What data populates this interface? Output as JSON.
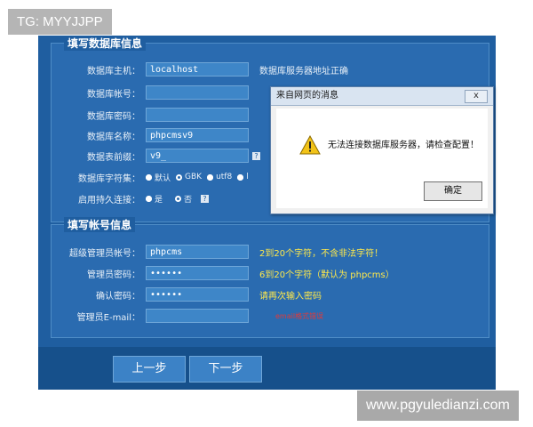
{
  "watermarks": {
    "top": "TG: MYYJJPP",
    "bottom": "www.pgyuledianzi.com"
  },
  "db_section": {
    "legend": "填写数据库信息",
    "host": {
      "label": "数据库主机：",
      "value": "localhost",
      "hint": "数据库服务器地址正确"
    },
    "user": {
      "label": "数据库帐号：",
      "value": ""
    },
    "password": {
      "label": "数据库密码：",
      "value": ""
    },
    "name": {
      "label": "数据库名称：",
      "value": "phpcmsv9"
    },
    "prefix": {
      "label": "数据表前缀：",
      "value": "v9_"
    },
    "charset": {
      "label": "数据库字符集：",
      "options": [
        "默认",
        "GBK",
        "utf8",
        "l"
      ]
    },
    "persistent": {
      "label": "启用持久连接：",
      "options": [
        "是",
        "否"
      ]
    }
  },
  "account_section": {
    "legend": "填写帐号信息",
    "admin_user": {
      "label": "超级管理员帐号：",
      "value": "phpcms",
      "hint": "2到20个字符，不含非法字符！"
    },
    "admin_pass": {
      "label": "管理员密码：",
      "value": "••••••",
      "hint": "6到20个字符（默认为 phpcms）"
    },
    "confirm_pass": {
      "label": "确认密码：",
      "value": "••••••",
      "hint": "请再次输入密码"
    },
    "email": {
      "label": "管理员E-mail：",
      "value": "",
      "hint": "email格式错误"
    }
  },
  "footer": {
    "prev": "上一步",
    "next": "下一步"
  },
  "dialog": {
    "title": "来自网页的消息",
    "close": "x",
    "message": "无法连接数据库服务器，请检查配置！",
    "ok": "确定"
  }
}
